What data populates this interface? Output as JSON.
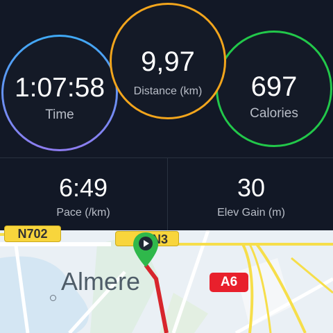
{
  "stats": {
    "time": {
      "value": "1:07:58",
      "label": "Time"
    },
    "distance": {
      "value": "9,97",
      "label": "Distance (km)"
    },
    "calories": {
      "value": "697",
      "label": "Calories"
    },
    "pace": {
      "value": "6:49",
      "label": "Pace (/km)"
    },
    "elev_gain": {
      "value": "30",
      "label": "Elev Gain (m)"
    }
  },
  "map": {
    "city": "Almere",
    "road_badges": {
      "n702": "N702",
      "partial": "N3",
      "a6": "A6"
    },
    "route_color": "#d7262c",
    "pin_color": "#2fb84b"
  },
  "colors": {
    "time_ring": "#3fa9f5",
    "distance_ring": "#f2a51c",
    "calories_ring": "#22c84a"
  }
}
